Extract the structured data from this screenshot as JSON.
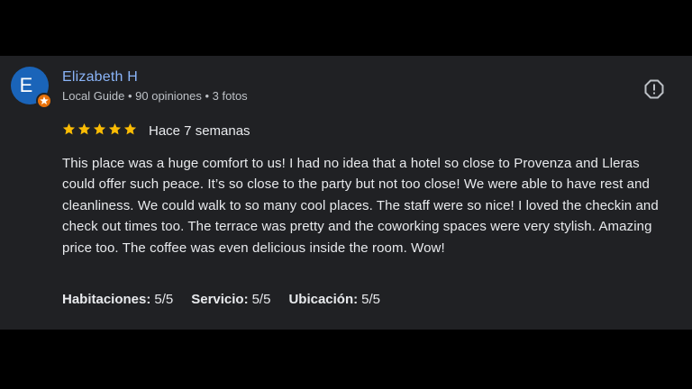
{
  "reviewer": {
    "avatar_letter": "E",
    "name": "Elizabeth H",
    "meta": "Local Guide • 90 opiniones • 3 fotos"
  },
  "review": {
    "stars": 5,
    "date": "Hace 7 semanas",
    "text": "This place was a huge comfort to us! I had no idea that a hotel so close to Provenza and Lleras could offer such peace. It’s so close to the party but not too close! We were able to have rest and cleanliness. We could walk to so many cool places. The staff were so nice! I loved the checkin and check out times too. The terrace was pretty and the coworking spaces were very stylish. Amazing price too. The coffee was even delicious inside the room. Wow!"
  },
  "ratings": [
    {
      "label": "Habitaciones:",
      "value": "5/5"
    },
    {
      "label": "Servicio:",
      "value": "5/5"
    },
    {
      "label": "Ubicación:",
      "value": "5/5"
    }
  ],
  "icons": {
    "avatar_badge": "local-guide-star-icon",
    "report": "report-flag-icon"
  },
  "colors": {
    "card_bg": "#202124",
    "name": "#8ab4f8",
    "star": "#fbbc04",
    "avatar": "#1a64b9",
    "badge": "#e8710a"
  }
}
